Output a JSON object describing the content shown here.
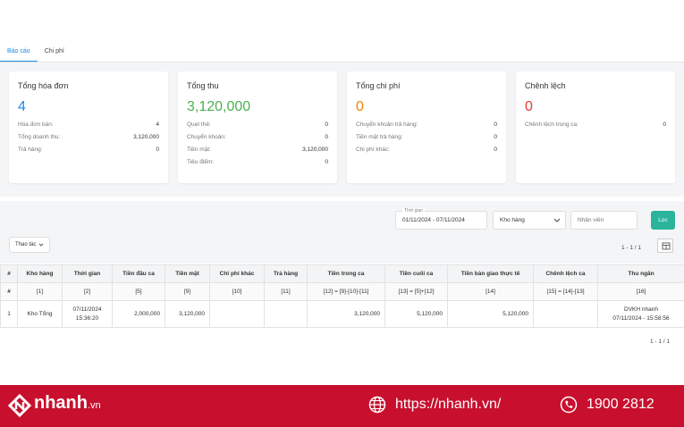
{
  "tabs": [
    "Báo cáo",
    "Chi phí"
  ],
  "cards": [
    {
      "title": "Tổng hóa đơn",
      "value": "4",
      "color": "#1e88e5",
      "rows": [
        {
          "label": "Hóa đơn bán:",
          "value": "4"
        },
        {
          "label": "Tổng doanh thu:",
          "value": "3,120,000"
        },
        {
          "label": "Trả hàng:",
          "value": "0"
        }
      ]
    },
    {
      "title": "Tổng thu",
      "value": "3,120,000",
      "color": "#4caf50",
      "rows": [
        {
          "label": "Quẹt thẻ:",
          "value": "0"
        },
        {
          "label": "Chuyển khoản:",
          "value": "0"
        },
        {
          "label": "Tiền mặt:",
          "value": "3,120,000"
        },
        {
          "label": "Tiêu điểm:",
          "value": "0"
        }
      ]
    },
    {
      "title": "Tổng chi phí",
      "value": "0",
      "color": "#f57c00",
      "rows": [
        {
          "label": "Chuyển khoản trả hàng:",
          "value": "0"
        },
        {
          "label": "Tiền mặt trả hàng:",
          "value": "0"
        },
        {
          "label": "Chi phí khác:",
          "value": "0"
        }
      ]
    },
    {
      "title": "Chênh lệch",
      "value": "0",
      "color": "#e53935",
      "rows": [
        {
          "label": "Chênh lệch trong ca:",
          "value": "0"
        }
      ]
    }
  ],
  "filters": {
    "time_label": "Thời gian",
    "time_value": "01/11/2024 - 07/11/2024",
    "warehouse_placeholder": "Kho hàng",
    "staff_placeholder": "Nhân viên",
    "filter_button": "Lọc",
    "actions_button": "Thao tác",
    "pager_top": "1 - 1 / 1",
    "pager_bottom": "1 - 1 / 1"
  },
  "table": {
    "headers": [
      "#",
      "Kho hàng",
      "Thời gian",
      "Tiền đầu ca",
      "Tiền mặt",
      "Chi phí khác",
      "Trả hàng",
      "Tiền trong ca",
      "Tiền cuối ca",
      "Tiền bàn giao thực tế",
      "Chênh lệch ca",
      "Thu ngân"
    ],
    "formulas": [
      "#",
      "[1]",
      "[2]",
      "[5]",
      "[9]",
      "[10]",
      "[11]",
      "[12] = [9]-[10]-[11]",
      "[13] = [5]+[12]",
      "[14]",
      "[15] = [14]-[13]",
      "[16]"
    ],
    "rows": [
      {
        "index": "1",
        "warehouse": "Kho Tổng",
        "time_date": "07/11/2024",
        "time_clock": "15:36:20",
        "opening": "2,000,000",
        "cash": "3,120,000",
        "other_cost": "",
        "returns": "",
        "in_shift": "3,120,000",
        "closing": "5,120,000",
        "handover": "5,120,000",
        "diff": "",
        "cashier_name": "DVKH nhanh",
        "cashier_time": "07/11/2024 - 15:58:56"
      }
    ]
  },
  "footer": {
    "brand": "nhanh",
    "brand_suffix": ".vn",
    "website": "https://nhanh.vn/",
    "hotline": "1900 2812",
    "color": "#c8102e"
  }
}
